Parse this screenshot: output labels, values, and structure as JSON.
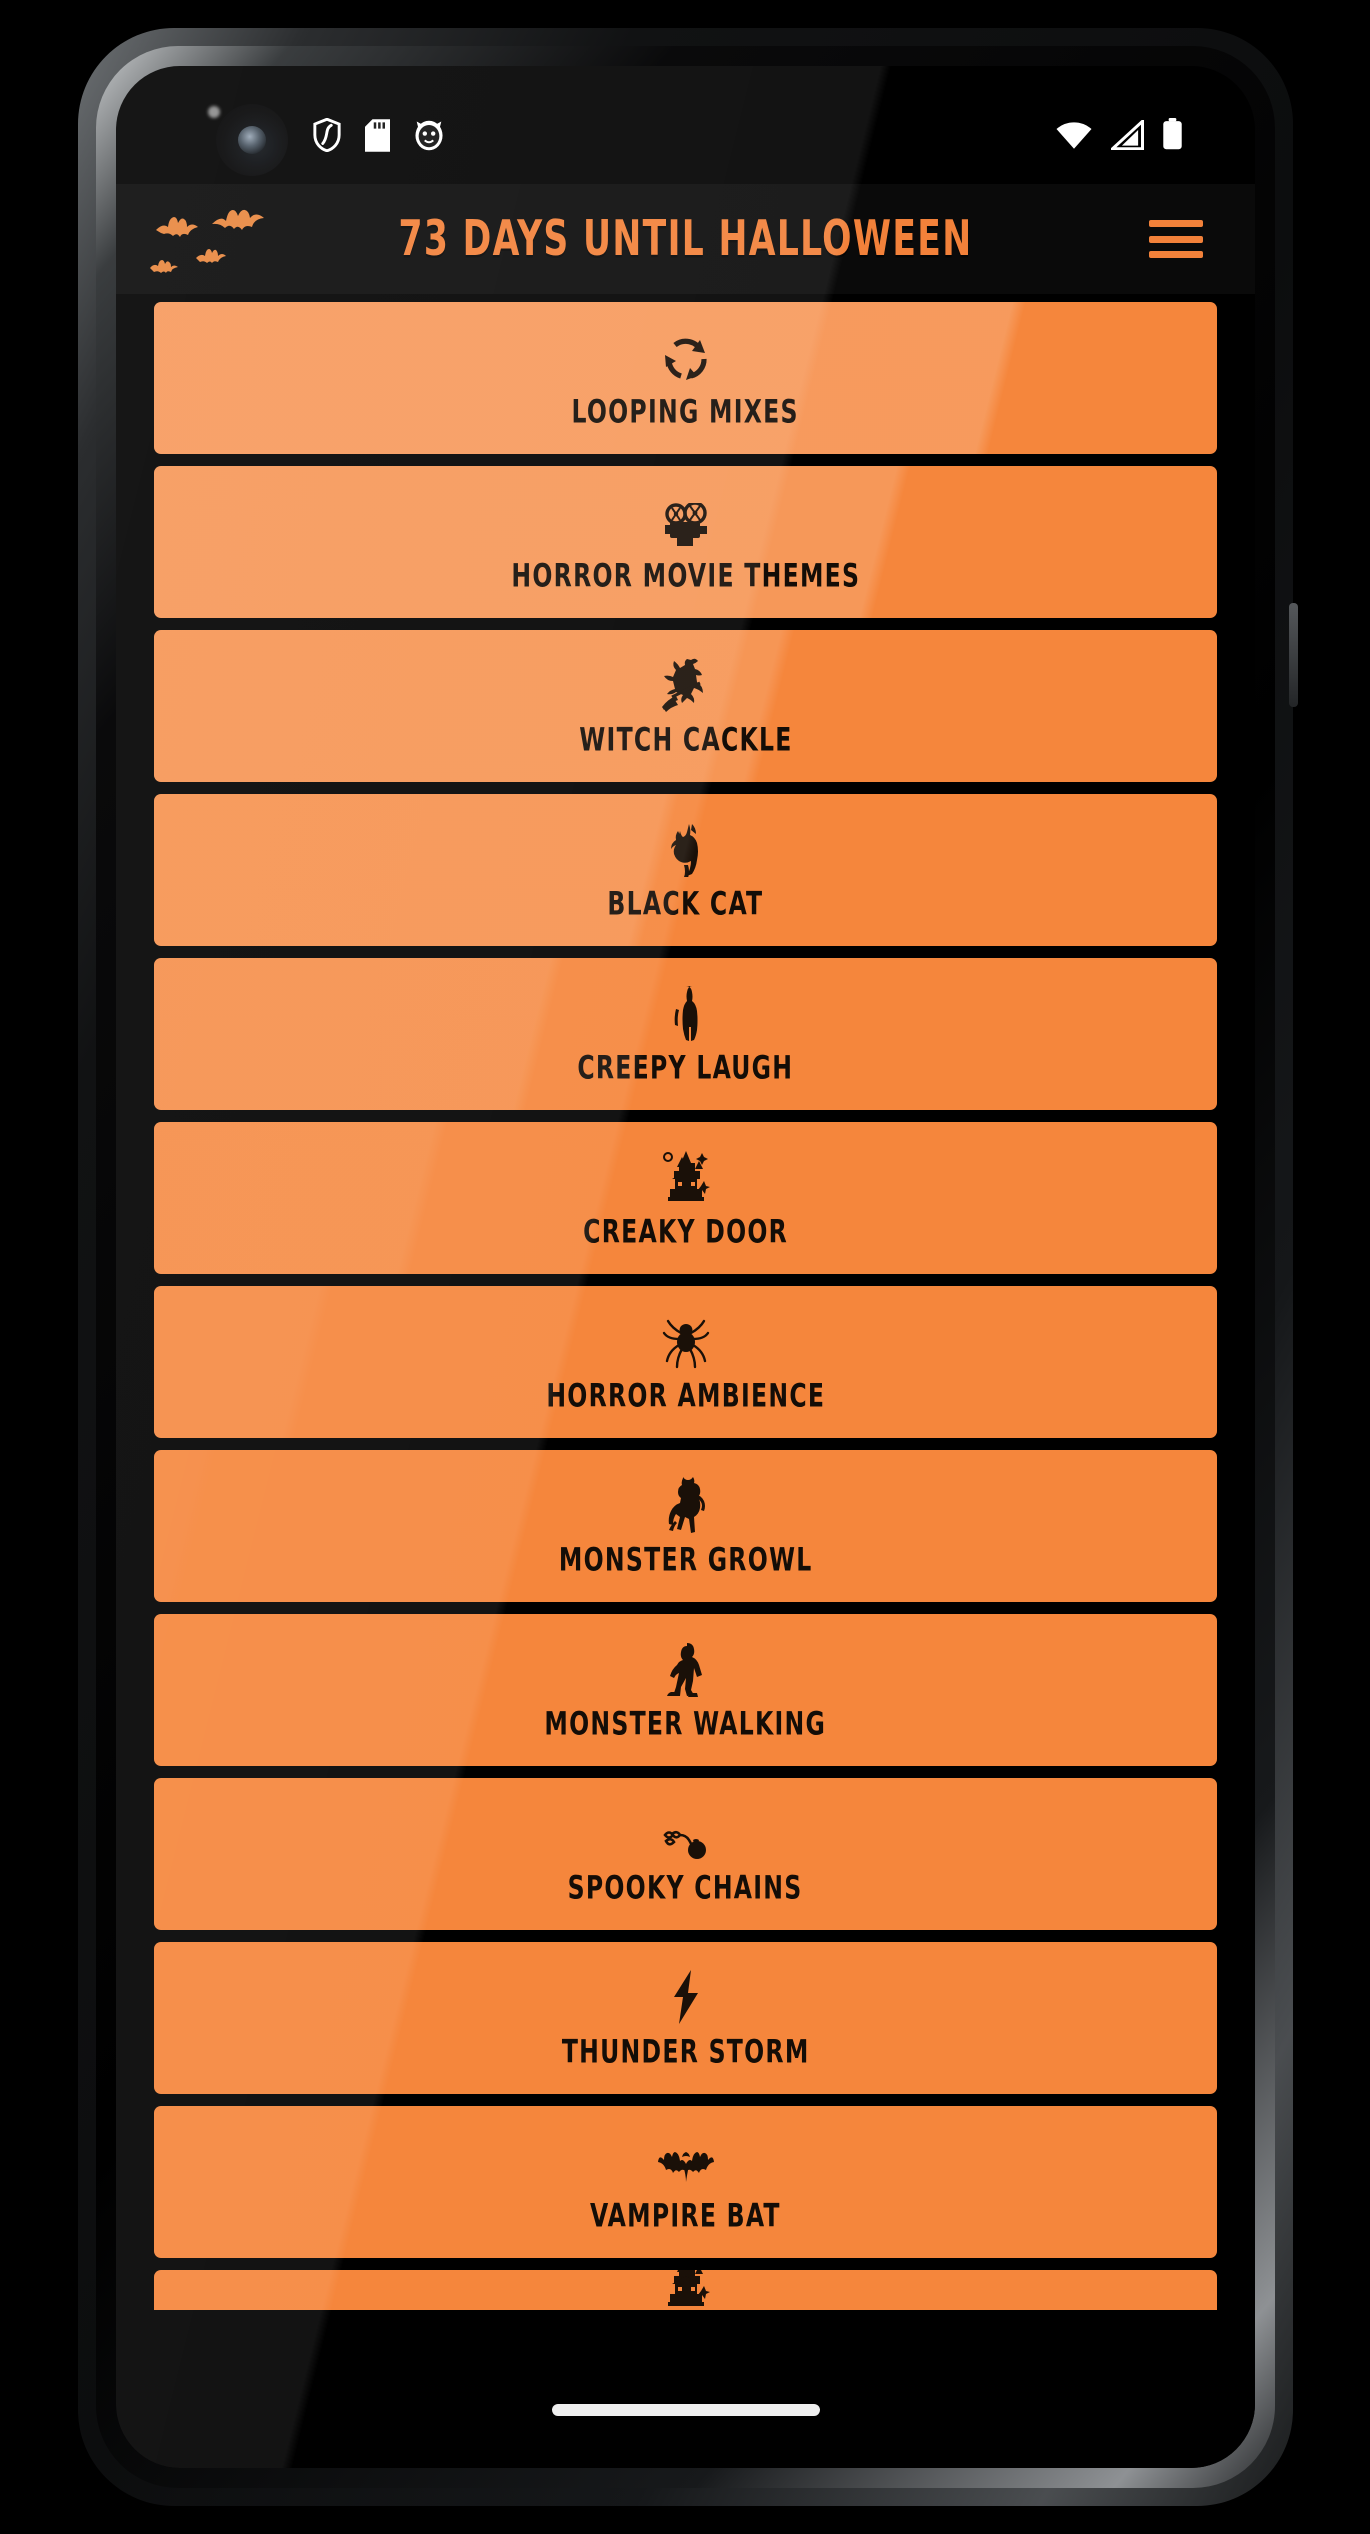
{
  "status_bar": {
    "left_icons": [
      "shield-icon",
      "sd-card-icon",
      "cat-face-icon"
    ],
    "right_icons": [
      "wifi-icon",
      "cellular-signal-icon",
      "battery-icon"
    ]
  },
  "header": {
    "title": "73 DAYS UNTIL HALLOWEEN",
    "days_until_halloween": 73,
    "bats_decoration": "flying-bats-icon",
    "menu_label": "menu-icon",
    "accent_color": "#F2813A",
    "background_color": "#0a0a0a"
  },
  "theme": {
    "card_orange": "#F5863C",
    "card_orange_light": "#F2944F",
    "text_dark": "#140d07",
    "screen_background": "#000000"
  },
  "sound_list": {
    "items": [
      {
        "label": "LOOPING MIXES",
        "icon": "loop-arrows-icon"
      },
      {
        "label": "HORROR MOVIE THEMES",
        "icon": "film-projector-icon"
      },
      {
        "label": "WITCH CACKLE",
        "icon": "witch-on-broom-icon"
      },
      {
        "label": "BLACK CAT",
        "icon": "arched-black-cat-icon"
      },
      {
        "label": "CREEPY LAUGH",
        "icon": "ghostly-figure-icon"
      },
      {
        "label": "CREAKY DOOR",
        "icon": "haunted-house-icon"
      },
      {
        "label": "HORROR AMBIENCE",
        "icon": "spider-icon"
      },
      {
        "label": "MONSTER GROWL",
        "icon": "monster-creature-icon"
      },
      {
        "label": "MONSTER WALKING",
        "icon": "bigfoot-walking-icon"
      },
      {
        "label": "SPOOKY CHAINS",
        "icon": "ball-and-chain-icon"
      },
      {
        "label": "THUNDER STORM",
        "icon": "lightning-bolt-icon"
      },
      {
        "label": "VAMPIRE BAT",
        "icon": "bat-icon"
      },
      {
        "label": "",
        "icon": "haunted-house-icon"
      }
    ]
  },
  "navigation": {
    "gesture_bar": "home-gesture-bar"
  }
}
